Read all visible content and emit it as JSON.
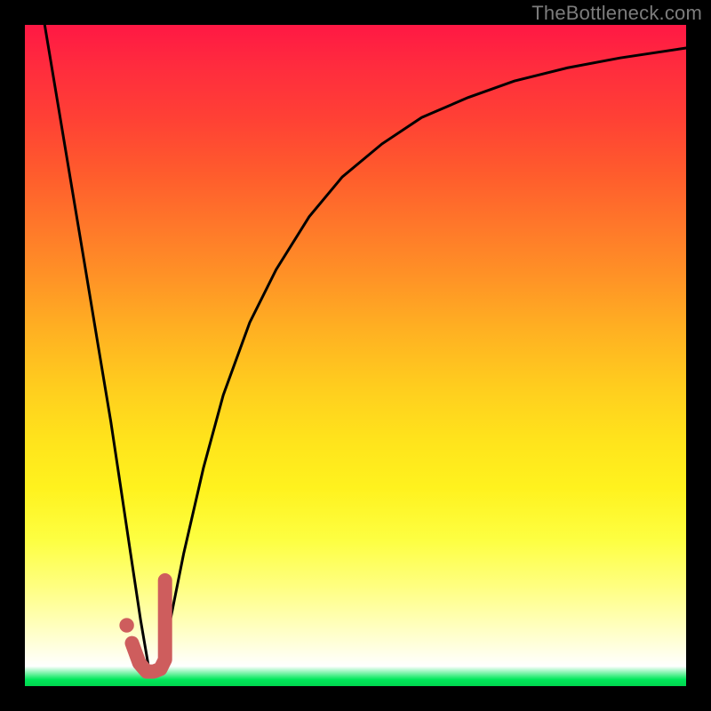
{
  "watermark": "TheBottleneck.com",
  "colors": {
    "curve": "#000000",
    "marker": "#ce5d5d",
    "frame": "#000000"
  },
  "chart_data": {
    "type": "line",
    "title": "",
    "xlabel": "",
    "ylabel": "",
    "xlim": [
      0,
      100
    ],
    "ylim": [
      0,
      100
    ],
    "series": [
      {
        "name": "bottleneck-curve",
        "x": [
          3,
          5,
          7,
          9,
          11,
          13,
          14.5,
          16,
          17.5,
          18.7,
          20,
          22,
          24,
          27,
          30,
          34,
          38,
          43,
          48,
          54,
          60,
          67,
          74,
          82,
          90,
          100
        ],
        "y": [
          100,
          88,
          76,
          64,
          52,
          40,
          30,
          20,
          10,
          3,
          2,
          10,
          20,
          33,
          44,
          55,
          63,
          71,
          77,
          82,
          86,
          89,
          91.5,
          93.5,
          95,
          96.5
        ]
      }
    ],
    "marker": {
      "name": "highlight-j",
      "points_x": [
        16.2,
        17.3,
        18.4,
        19.5,
        20.5,
        21.2,
        21.2,
        21.2,
        21.2,
        21.2
      ],
      "points_y": [
        6.5,
        3.5,
        2.2,
        2.2,
        2.6,
        4.0,
        7.0,
        10.0,
        13.0,
        16.0
      ],
      "dot": {
        "x": 15.4,
        "y": 9.2,
        "r": 1.1
      }
    }
  }
}
